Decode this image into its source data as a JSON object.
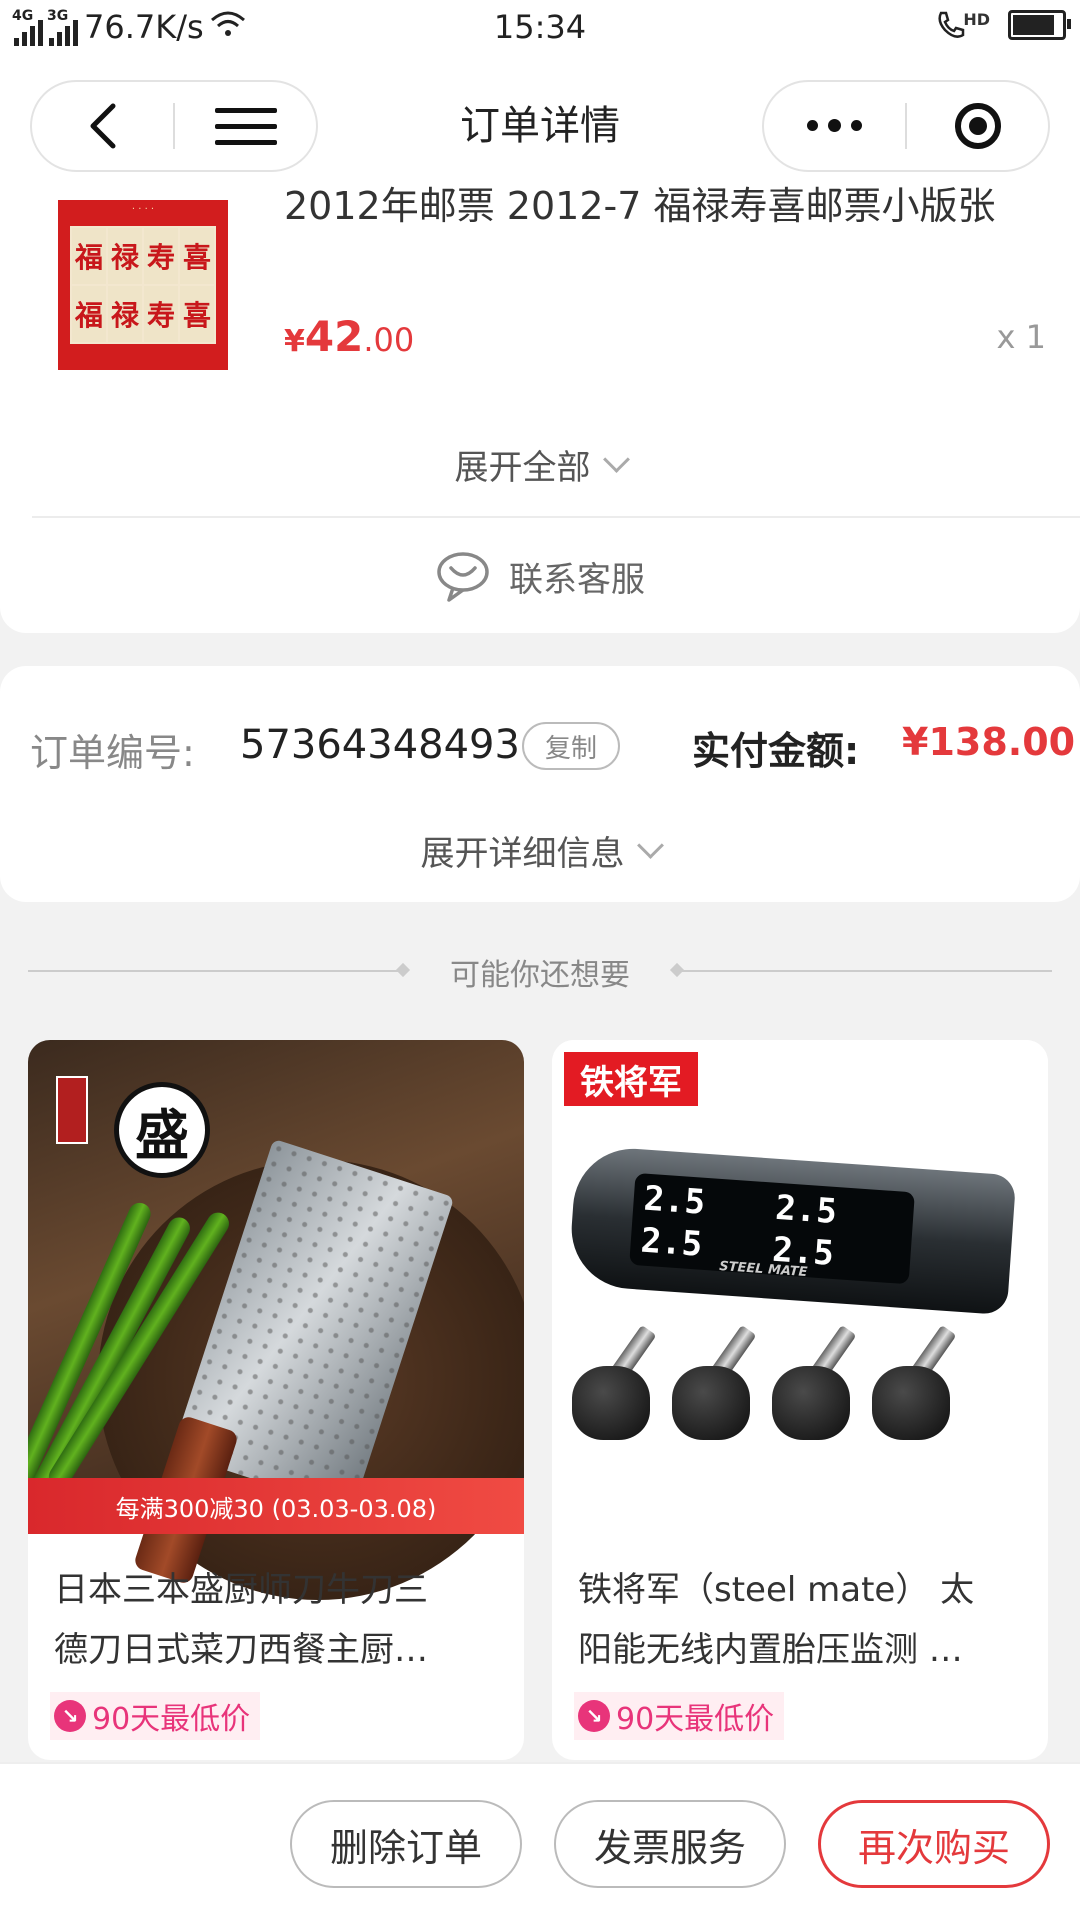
{
  "status_bar": {
    "net1": "4G",
    "net2": "3G",
    "speed": "76.7K/s",
    "time": "15:34",
    "hd": "HD",
    "battery_level_percent": 90
  },
  "nav": {
    "title": "订单详情"
  },
  "product": {
    "title": "2012年邮票 2012-7 福禄寿喜邮票小版张",
    "price_symbol": "¥",
    "price_int": "42",
    "price_dec": ".00",
    "qty": "x 1",
    "stamp_chars": [
      "福",
      "禄",
      "寿",
      "喜",
      "福",
      "禄",
      "寿",
      "喜"
    ]
  },
  "expand_all": "展开全部",
  "contact": "联系客服",
  "order": {
    "label": "订单编号:",
    "number": "57364348493",
    "copy": "复制",
    "paid_label": "实付金额:",
    "paid_amount": "¥138.00",
    "expand_detail": "展开详细信息"
  },
  "recommend": {
    "title": "可能你还想要",
    "items": [
      {
        "brand": "盛",
        "promo": "每满300减30 (03.03-03.08)",
        "name_line1": "日本三本盛厨师刀牛刀三",
        "name_line2": "德刀日式菜刀西餐主厨…",
        "lowest": "90天最低价"
      },
      {
        "badge": "铁将军",
        "screen": [
          "2.5",
          "2.5",
          "2.5",
          "2.5"
        ],
        "device_label": "STEEL MATE",
        "name_line1": "铁将军（steel mate） 太",
        "name_line2": "阳能无线内置胎压监测 …",
        "lowest": "90天最低价"
      }
    ]
  },
  "bottom": {
    "delete": "删除订单",
    "invoice": "发票服务",
    "rebuy": "再次购买"
  },
  "colors": {
    "accent": "#e4393c",
    "pink": "#e8347a"
  }
}
